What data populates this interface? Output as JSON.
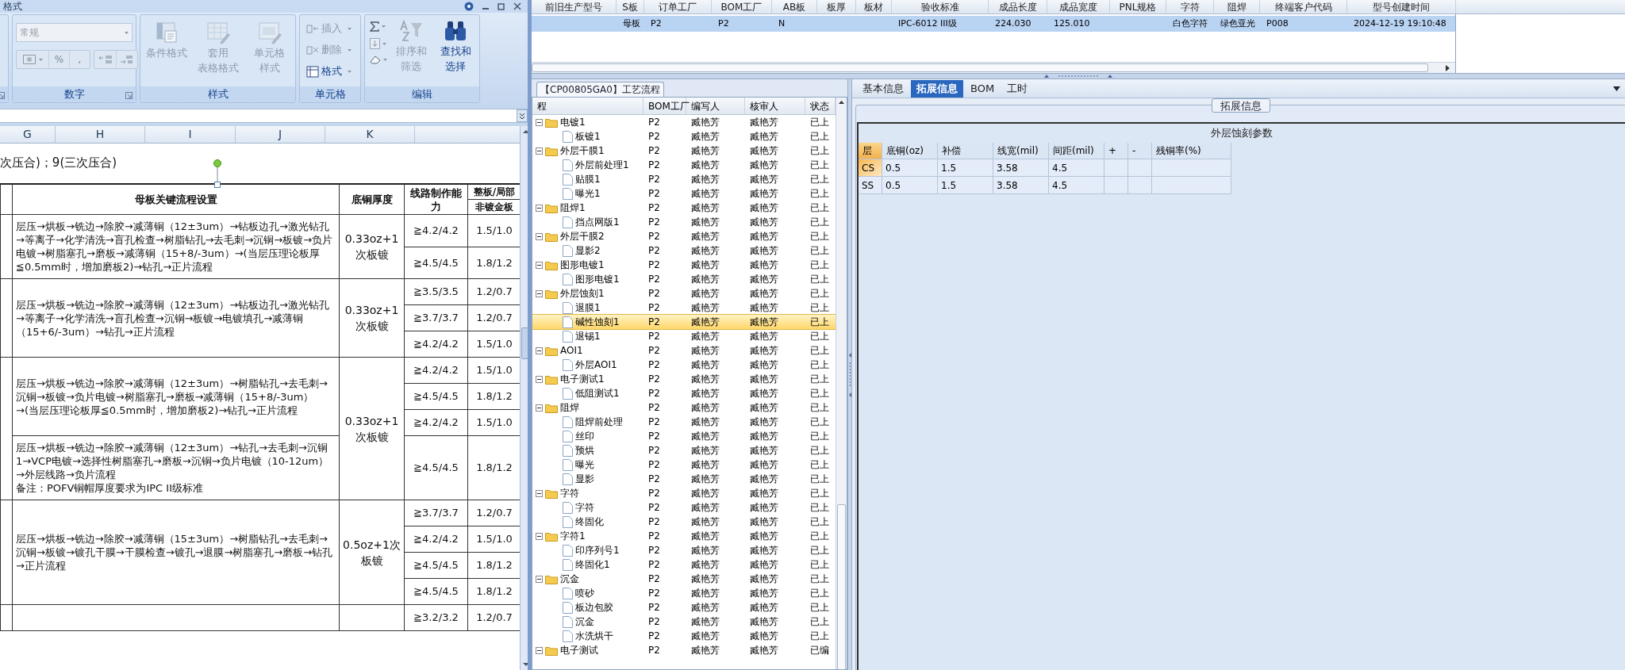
{
  "excel": {
    "title": "格式",
    "ribbon": [
      {
        "kind": "cut"
      },
      {
        "kind": "number",
        "label": "数字",
        "dropdown": "常规",
        "symbols": [
          "%",
          ","
        ]
      },
      {
        "kind": "large",
        "label": "样式",
        "buttons": [
          {
            "lines": [
              "条件格式"
            ],
            "disabled": true
          },
          {
            "lines": [
              "套用",
              "表格格式"
            ],
            "disabled": true
          },
          {
            "lines": [
              "单元格",
              "样式"
            ],
            "disabled": true
          }
        ]
      },
      {
        "kind": "small",
        "label": "单元格",
        "buttons": [
          {
            "label": "插入",
            "disabled": true
          },
          {
            "label": "删除",
            "disabled": true
          },
          {
            "label": "格式",
            "disabled": false
          }
        ]
      },
      {
        "kind": "edit",
        "label": "编辑",
        "buttons": [
          {
            "lines": [
              "排序和",
              "筛选"
            ],
            "disabled": true
          },
          {
            "lines": [
              "查找和",
              "选择"
            ],
            "disabled": false
          }
        ]
      }
    ],
    "column_headers": [
      "G",
      "H",
      "I",
      "J",
      "K"
    ],
    "note": "次压合)；9(三次压合)",
    "table": {
      "headers": [
        "母板关键流程设置",
        "底铜厚度",
        "线路制作能力"
      ],
      "split_header_top": "整板/局部",
      "split_header_bottom": "非镀金板",
      "blocks": [
        {
          "copper": "0.33oz+1次板镀",
          "processes": [
            {
              "text": "层压→烘板→铣边→除胶→减薄铜（12±3um）→钻板边孔→激光钻孔→等离子→化学清洗→盲孔检查→树脂钻孔→去毛刺→沉铜→板镀→负片电镀→树脂塞孔→磨板→减薄铜（15+8/-3um）→(当层压理论板厚≦0.5mm时，增加磨板2)→钻孔→正片流程",
              "rows": [
                [
                  "≧4.2/4.2",
                  "1.5/1.0"
                ],
                [
                  "≧4.5/4.5",
                  "1.8/1.2"
                ]
              ]
            }
          ]
        },
        {
          "copper": "0.33oz+1次板镀",
          "processes": [
            {
              "text": "层压→烘板→铣边→除胶→减薄铜（12±3um）→钻板边孔→激光钻孔→等离子→化学清洗→盲孔检查→沉铜→板镀→电镀填孔→减薄铜（15+6/-3um）→钻孔→正片流程",
              "rows": [
                [
                  "≧3.5/3.5",
                  "1.2/0.7"
                ],
                [
                  "≧3.7/3.7",
                  "1.2/0.7"
                ],
                [
                  "≧4.2/4.2",
                  "1.5/1.0"
                ]
              ]
            }
          ]
        },
        {
          "copper": "0.33oz+1次板镀",
          "processes": [
            {
              "text": "层压→烘板→铣边→除胶→减薄铜（12±3um）→树脂钻孔→去毛刺→沉铜→板镀→负片电镀→树脂塞孔→磨板→减薄铜（15+8/-3um）→(当层压理论板厚≦0.5mm时，增加磨板2)→钻孔→正片流程",
              "rows": [
                [
                  "≧4.2/4.2",
                  "1.5/1.0"
                ],
                [
                  "≧4.5/4.5",
                  "1.8/1.2"
                ],
                [
                  "≧4.2/4.2",
                  "1.5/1.0"
                ]
              ]
            },
            {
              "text": "层压→烘板→铣边→除胶→减薄铜（12±3um）→钻孔→去毛刺→沉铜1→VCP电镀→选择性树脂塞孔→磨板→沉铜→负片电镀（10-12um）→外层线路→负片流程",
              "note": "备注：POFV铜帽厚度要求为IPC II级标准",
              "rows": [
                [
                  "≧4.5/4.5",
                  "1.8/1.2"
                ]
              ]
            }
          ]
        },
        {
          "copper": "0.5oz+1次板镀",
          "processes": [
            {
              "text": "层压→烘板→铣边→除胶→减薄铜（15±3um）→树脂钻孔→去毛刺→沉铜→板镀→镀孔干膜→干膜检查→镀孔→退膜→树脂塞孔→磨板→钻孔→正片流程",
              "rows": [
                [
                  "≧3.7/3.7",
                  "1.2/0.7"
                ],
                [
                  "≧4.2/4.2",
                  "1.5/1.0"
                ],
                [
                  "≧4.5/4.5",
                  "1.8/1.2"
                ],
                [
                  "≧4.5/4.5",
                  "1.8/1.2"
                ]
              ]
            }
          ]
        },
        {
          "processes": [
            {
              "rows": [
                [
                  "≧3.2/3.2",
                  "1.2/0.7"
                ]
              ]
            }
          ]
        }
      ]
    }
  },
  "model_grid": {
    "columns": [
      "前旧生产型号",
      "S板",
      "订单工厂",
      "BOM工厂",
      "AB板",
      "板厚",
      "板材",
      "验收标准",
      "成品长度",
      "成品宽度",
      "PNL规格",
      "字符",
      "阻焊",
      "终端客户代码",
      "型号创建时间"
    ],
    "rows": [
      {
        "selected": true,
        "cells": [
          null,
          "母板",
          "P2",
          "P2",
          "N",
          null,
          null,
          "IPC-6012 III级",
          "224.030",
          "125.010",
          null,
          "白色字符",
          "绿色亚光",
          "P008",
          "2024-12-19 19:10:48"
        ]
      }
    ]
  },
  "process_tree": {
    "tab": "【CP00805GA0】工艺流程",
    "columns": [
      "程",
      "BOM工厂",
      "编写人",
      "核审人",
      "状态"
    ],
    "items": [
      {
        "kind": "folder",
        "label": "电镀1",
        "bom": "P2",
        "writer": "臧艳芳",
        "reviewer": "臧艳芳",
        "status": "已上",
        "selected": false,
        "expanded": true,
        "children": [
          {
            "kind": "step",
            "label": "板镀1",
            "bom": "P2",
            "writer": "臧艳芳",
            "reviewer": "臧艳芳",
            "status": "已上",
            "selected": false
          }
        ]
      },
      {
        "kind": "folder",
        "label": "外层干膜1",
        "bom": "P2",
        "writer": "臧艳芳",
        "reviewer": "臧艳芳",
        "status": "已上",
        "selected": false,
        "expanded": true,
        "children": [
          {
            "kind": "step",
            "label": "外层前处理1",
            "bom": "P2",
            "writer": "臧艳芳",
            "reviewer": "臧艳芳",
            "status": "已上",
            "selected": false
          },
          {
            "kind": "step",
            "label": "贴膜1",
            "bom": "P2",
            "writer": "臧艳芳",
            "reviewer": "臧艳芳",
            "status": "已上",
            "selected": false
          },
          {
            "kind": "step",
            "label": "曝光1",
            "bom": "P2",
            "writer": "臧艳芳",
            "reviewer": "臧艳芳",
            "status": "已上",
            "selected": false
          }
        ]
      },
      {
        "kind": "folder",
        "label": "阻焊1",
        "bom": "P2",
        "writer": "臧艳芳",
        "reviewer": "臧艳芳",
        "status": "已上",
        "selected": false,
        "expanded": true,
        "children": [
          {
            "kind": "step",
            "label": "挡点网版1",
            "bom": "P2",
            "writer": "臧艳芳",
            "reviewer": "臧艳芳",
            "status": "已上",
            "selected": false
          }
        ]
      },
      {
        "kind": "folder",
        "label": "外层干膜2",
        "bom": "P2",
        "writer": "臧艳芳",
        "reviewer": "臧艳芳",
        "status": "已上",
        "selected": false,
        "expanded": true,
        "children": [
          {
            "kind": "step",
            "label": "显影2",
            "bom": "P2",
            "writer": "臧艳芳",
            "reviewer": "臧艳芳",
            "status": "已上",
            "selected": false
          }
        ]
      },
      {
        "kind": "folder",
        "label": "图形电镀1",
        "bom": "P2",
        "writer": "臧艳芳",
        "reviewer": "臧艳芳",
        "status": "已上",
        "selected": false,
        "expanded": true,
        "children": [
          {
            "kind": "step",
            "label": "图形电镀1",
            "bom": "P2",
            "writer": "臧艳芳",
            "reviewer": "臧艳芳",
            "status": "已上",
            "selected": false
          }
        ]
      },
      {
        "kind": "folder",
        "label": "外层蚀刻1",
        "bom": "P2",
        "writer": "臧艳芳",
        "reviewer": "臧艳芳",
        "status": "已上",
        "selected": false,
        "expanded": true,
        "children": [
          {
            "kind": "step",
            "label": "退膜1",
            "bom": "P2",
            "writer": "臧艳芳",
            "reviewer": "臧艳芳",
            "status": "已上",
            "selected": false
          },
          {
            "kind": "step",
            "label": "碱性蚀刻1",
            "bom": "P2",
            "writer": "臧艳芳",
            "reviewer": "臧艳芳",
            "status": "已上",
            "selected": true
          },
          {
            "kind": "step",
            "label": "退锡1",
            "bom": "P2",
            "writer": "臧艳芳",
            "reviewer": "臧艳芳",
            "status": "已上",
            "selected": false
          }
        ]
      },
      {
        "kind": "folder",
        "label": "AOI1",
        "bom": "P2",
        "writer": "臧艳芳",
        "reviewer": "臧艳芳",
        "status": "已上",
        "selected": false,
        "expanded": true,
        "children": [
          {
            "kind": "step",
            "label": "外层AOI1",
            "bom": "P2",
            "writer": "臧艳芳",
            "reviewer": "臧艳芳",
            "status": "已上",
            "selected": false
          }
        ]
      },
      {
        "kind": "folder",
        "label": "电子测试1",
        "bom": "P2",
        "writer": "臧艳芳",
        "reviewer": "臧艳芳",
        "status": "已上",
        "selected": false,
        "expanded": true,
        "children": [
          {
            "kind": "step",
            "label": "低阻测试1",
            "bom": "P2",
            "writer": "臧艳芳",
            "reviewer": "臧艳芳",
            "status": "已上",
            "selected": false
          }
        ]
      },
      {
        "kind": "folder",
        "label": "阻焊",
        "bom": "P2",
        "writer": "臧艳芳",
        "reviewer": "臧艳芳",
        "status": "已上",
        "selected": false,
        "expanded": true,
        "children": [
          {
            "kind": "step",
            "label": "阻焊前处理",
            "bom": "P2",
            "writer": "臧艳芳",
            "reviewer": "臧艳芳",
            "status": "已上",
            "selected": false
          },
          {
            "kind": "step",
            "label": "丝印",
            "bom": "P2",
            "writer": "臧艳芳",
            "reviewer": "臧艳芳",
            "status": "已上",
            "selected": false
          },
          {
            "kind": "step",
            "label": "预烘",
            "bom": "P2",
            "writer": "臧艳芳",
            "reviewer": "臧艳芳",
            "status": "已上",
            "selected": false
          },
          {
            "kind": "step",
            "label": "曝光",
            "bom": "P2",
            "writer": "臧艳芳",
            "reviewer": "臧艳芳",
            "status": "已上",
            "selected": false
          },
          {
            "kind": "step",
            "label": "显影",
            "bom": "P2",
            "writer": "臧艳芳",
            "reviewer": "臧艳芳",
            "status": "已上",
            "selected": false
          }
        ]
      },
      {
        "kind": "folder",
        "label": "字符",
        "bom": "P2",
        "writer": "臧艳芳",
        "reviewer": "臧艳芳",
        "status": "已上",
        "selected": false,
        "expanded": true,
        "children": [
          {
            "kind": "step",
            "label": "字符",
            "bom": "P2",
            "writer": "臧艳芳",
            "reviewer": "臧艳芳",
            "status": "已上",
            "selected": false
          },
          {
            "kind": "step",
            "label": "终固化",
            "bom": "P2",
            "writer": "臧艳芳",
            "reviewer": "臧艳芳",
            "status": "已上",
            "selected": false
          }
        ]
      },
      {
        "kind": "folder",
        "label": "字符1",
        "bom": "P2",
        "writer": "臧艳芳",
        "reviewer": "臧艳芳",
        "status": "已上",
        "selected": false,
        "expanded": true,
        "children": [
          {
            "kind": "step",
            "label": "印序列号1",
            "bom": "P2",
            "writer": "臧艳芳",
            "reviewer": "臧艳芳",
            "status": "已上",
            "selected": false
          },
          {
            "kind": "step",
            "label": "终固化1",
            "bom": "P2",
            "writer": "臧艳芳",
            "reviewer": "臧艳芳",
            "status": "已上",
            "selected": false
          }
        ]
      },
      {
        "kind": "folder",
        "label": "沉金",
        "bom": "P2",
        "writer": "臧艳芳",
        "reviewer": "臧艳芳",
        "status": "已上",
        "selected": false,
        "expanded": true,
        "children": [
          {
            "kind": "step",
            "label": "喷砂",
            "bom": "P2",
            "writer": "臧艳芳",
            "reviewer": "臧艳芳",
            "status": "已上",
            "selected": false
          },
          {
            "kind": "step",
            "label": "板边包胶",
            "bom": "P2",
            "writer": "臧艳芳",
            "reviewer": "臧艳芳",
            "status": "已上",
            "selected": false
          },
          {
            "kind": "step",
            "label": "沉金",
            "bom": "P2",
            "writer": "臧艳芳",
            "reviewer": "臧艳芳",
            "status": "已上",
            "selected": false
          },
          {
            "kind": "step",
            "label": "水洗烘干",
            "bom": "P2",
            "writer": "臧艳芳",
            "reviewer": "臧艳芳",
            "status": "已上",
            "selected": false
          }
        ]
      },
      {
        "kind": "folder",
        "label": "电子测试",
        "bom": "P2",
        "writer": "臧艳芳",
        "reviewer": "臧艳芳",
        "status": "已编",
        "selected": false,
        "expanded": true
      }
    ]
  },
  "detail": {
    "tabs": [
      {
        "label": "基本信息",
        "selected": false
      },
      {
        "label": "拓展信息",
        "selected": true
      },
      {
        "label": "BOM",
        "selected": false
      },
      {
        "label": "工时",
        "selected": false
      }
    ],
    "group_title": "拓展信息",
    "section_title": "外层蚀刻参数",
    "params": {
      "columns": [
        "层",
        "底铜(oz)",
        "补偿",
        "线宽(mil)",
        "间距(mil)",
        "+",
        "-",
        "残铜率(%)"
      ],
      "rows": [
        {
          "selected": true,
          "cells": [
            "CS",
            "0.5",
            "1.5",
            "3.58",
            "4.5"
          ]
        },
        {
          "selected": false,
          "cells": [
            "SS",
            "0.5",
            "1.5",
            "3.58",
            "4.5"
          ]
        }
      ]
    }
  }
}
